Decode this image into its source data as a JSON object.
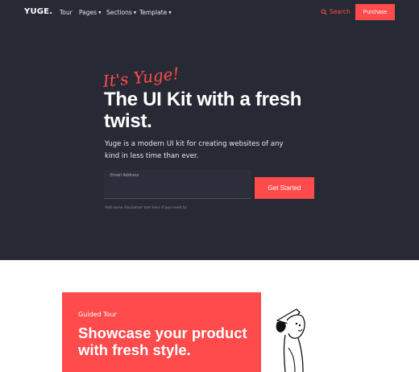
{
  "nav": {
    "logo": "YUGE.",
    "links": [
      {
        "label": "Tour",
        "has_menu": false
      },
      {
        "label": "Pages",
        "has_menu": true
      },
      {
        "label": "Sections",
        "has_menu": true
      },
      {
        "label": "Template",
        "has_menu": true
      }
    ],
    "search_label": "Search",
    "purchase_label": "Purchase"
  },
  "hero": {
    "script_text": "It's Yuge!",
    "headline": "The UI Kit with a fresh twist.",
    "subtitle": "Yuge is a modern UI kit for creating websites of any kind in less time than ever.",
    "email_label": "Email Address",
    "email_value": "",
    "cta_label": "Get Started",
    "disclaimer": "Add some disclaimer text here if you need to"
  },
  "tour": {
    "label": "Guided Tour",
    "title": "Showcase your product with fresh style."
  },
  "colors": {
    "accent": "#ff4b4b",
    "hero_bg": "#272a35",
    "text_light": "#ffffff"
  },
  "icons": {
    "search": "search-icon",
    "caret": "caret-down-icon"
  }
}
